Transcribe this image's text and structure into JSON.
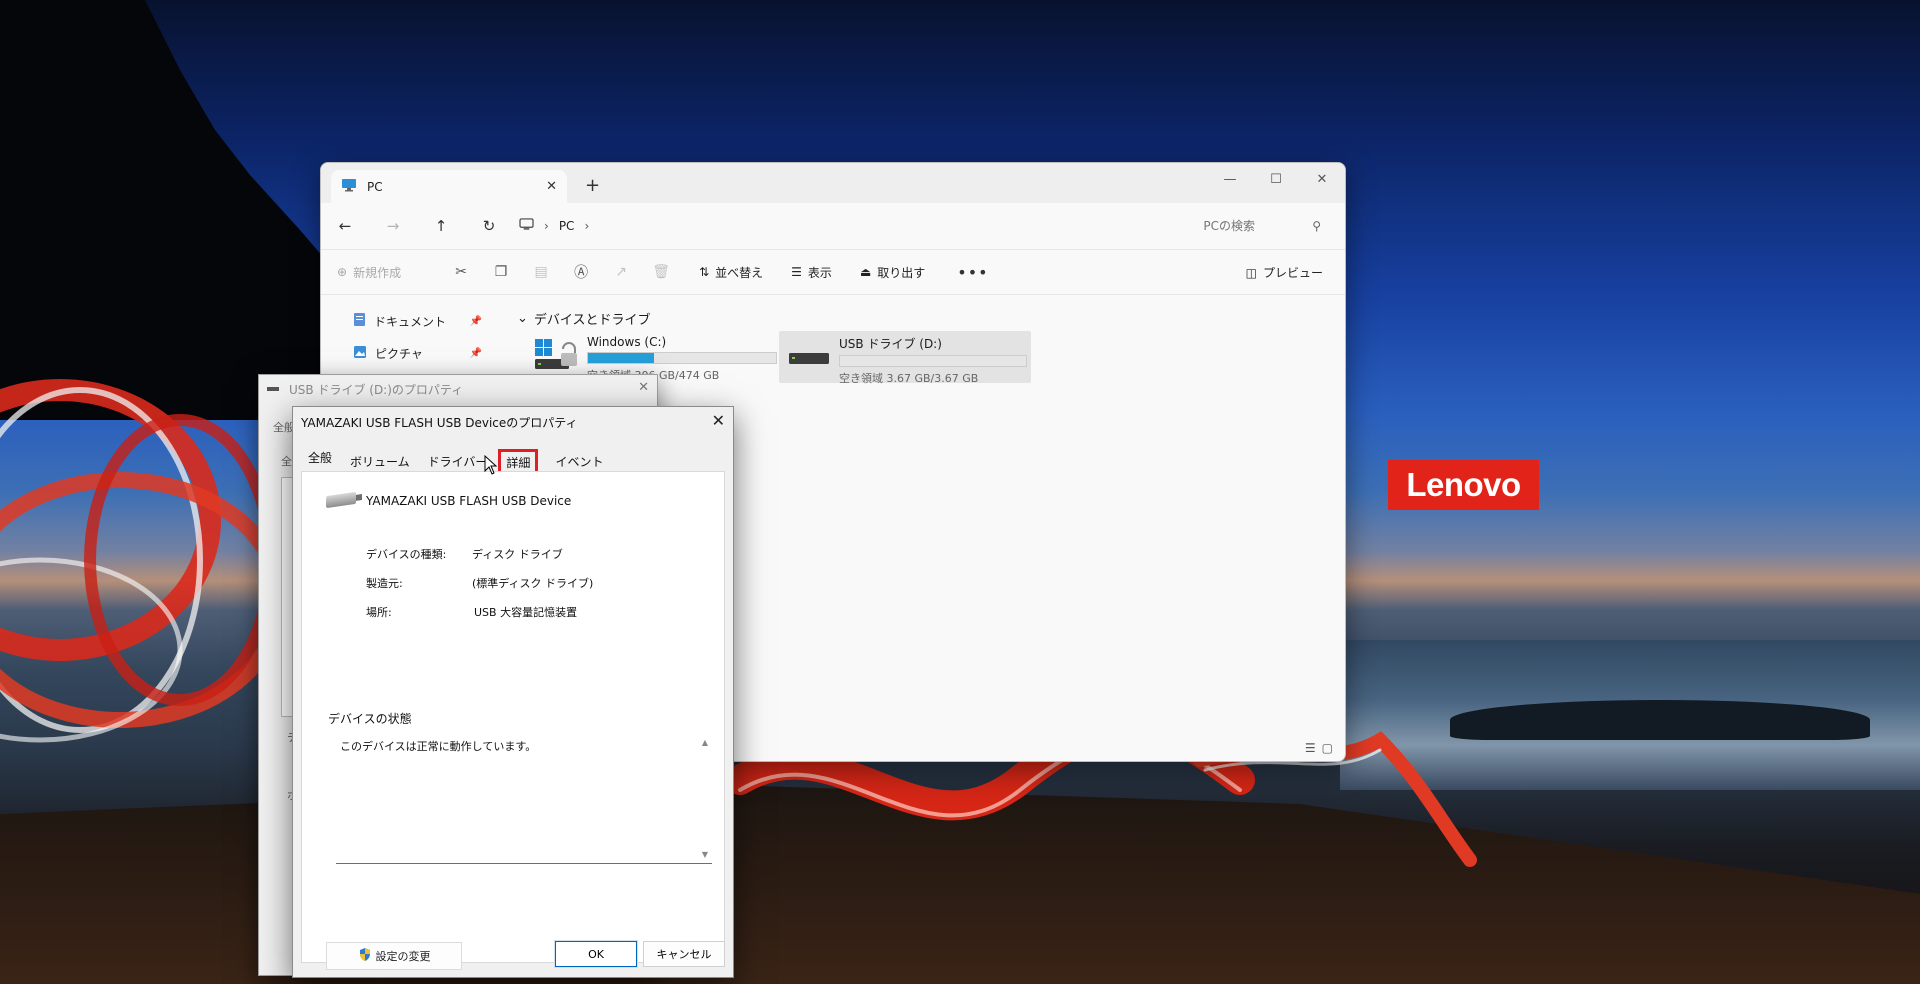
{
  "branding": {
    "logo_text": "Lenovo",
    "logo_color": "#e2231a"
  },
  "explorer": {
    "tab_title": "PC",
    "breadcrumb": [
      "PC"
    ],
    "search_placeholder": "PCの検索",
    "toolbar": {
      "new_label": "新規作成",
      "sort_label": "並べ替え",
      "view_label": "表示",
      "eject_label": "取り出す",
      "preview_label": "プレビュー"
    },
    "nav_items": [
      {
        "label": "ドキュメント",
        "icon": "document-icon"
      },
      {
        "label": "ピクチャ",
        "icon": "picture-icon"
      }
    ],
    "section_header": "デバイスとドライブ",
    "drives": [
      {
        "name": "Windows (C:)",
        "free_text": "空き領域 306 GB/474 GB",
        "used_fraction": 0.35,
        "bar_color": "#26a0da"
      },
      {
        "name": "USB ドライブ (D:)",
        "free_text": "空き領域 3.67 GB/3.67 GB",
        "used_fraction": 0.0,
        "bar_color": "#26a0da"
      }
    ]
  },
  "props_window": {
    "title": "USB ドライブ (D:)のプロパティ",
    "fragments": [
      "全般",
      "全",
      "名",
      "デ",
      "ポ"
    ]
  },
  "device_dialog": {
    "title": "YAMAZAKI USB FLASH USB Deviceのプロパティ",
    "tabs": [
      "全般",
      "ボリューム",
      "ドライバー",
      "詳細",
      "イベント"
    ],
    "highlight_color": "#e01e26",
    "device_name": "YAMAZAKI USB FLASH USB Device",
    "fields": [
      {
        "key": "デバイスの種類:",
        "value": "ディスク ドライブ"
      },
      {
        "key": "製造元:",
        "value": "(標準ディスク ドライブ)"
      },
      {
        "key": "場所:",
        "value": "USB 大容量記憶装置"
      }
    ],
    "status_header": "デバイスの状態",
    "status_text": "このデバイスは正常に動作しています。",
    "change_settings_label": "設定の変更",
    "ok_label": "OK",
    "cancel_label": "キャンセル"
  }
}
